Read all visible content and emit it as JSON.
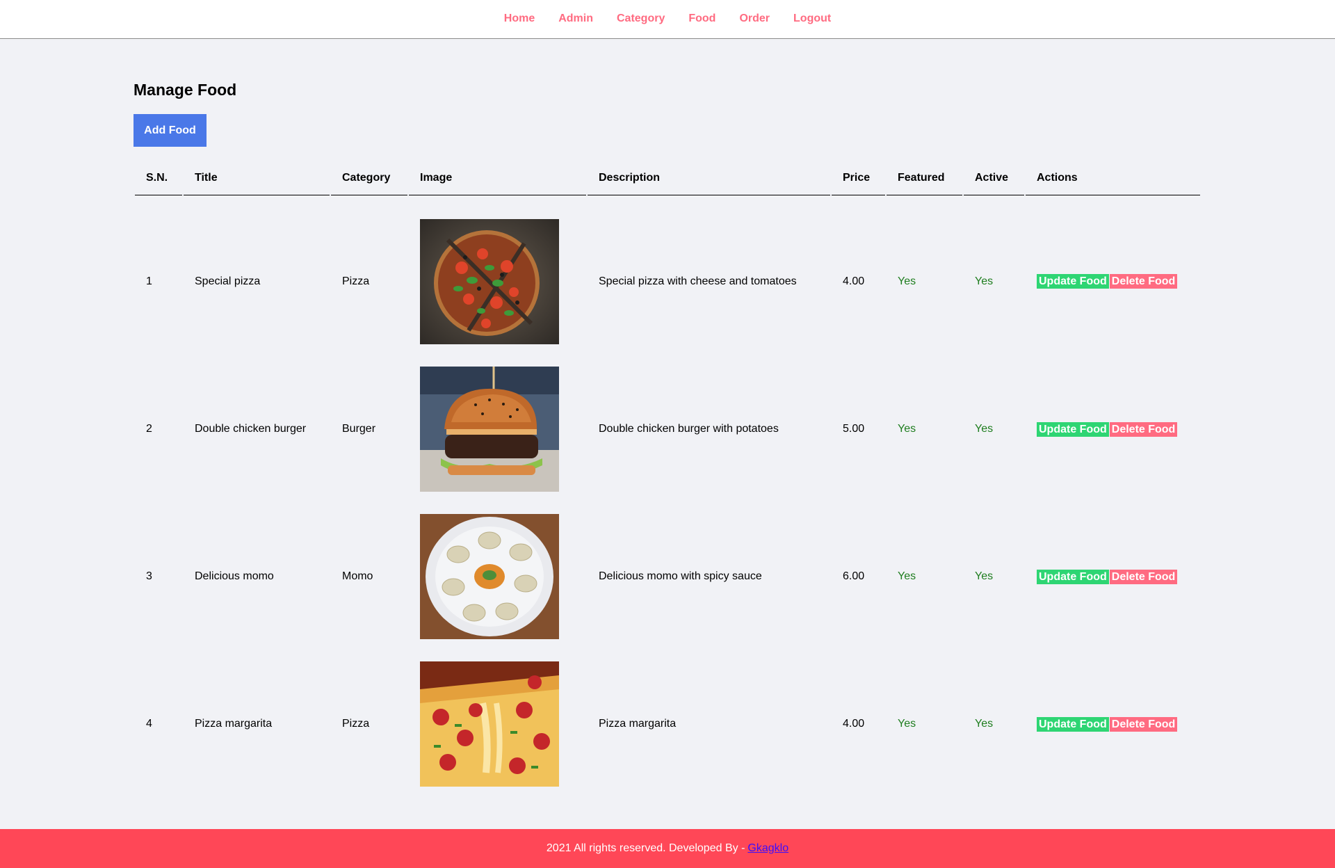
{
  "nav": {
    "items": [
      {
        "label": "Home"
      },
      {
        "label": "Admin"
      },
      {
        "label": "Category"
      },
      {
        "label": "Food"
      },
      {
        "label": "Order"
      },
      {
        "label": "Logout"
      }
    ],
    "color": "#ff6b81"
  },
  "main": {
    "title": "Manage Food",
    "add_button_label": "Add Food",
    "add_button_color": "#4a78e8"
  },
  "table": {
    "headers": [
      "S.N.",
      "Title",
      "Category",
      "Image",
      "Description",
      "Price",
      "Featured",
      "Active",
      "Actions"
    ],
    "rows": [
      {
        "sn": "1",
        "title": "Special pizza",
        "category": "Pizza",
        "image_icon": "pizza-slices-image",
        "description": "Special pizza with cheese and tomatoes",
        "price": "4.00",
        "featured": "Yes",
        "active": "Yes"
      },
      {
        "sn": "2",
        "title": "Double chicken burger",
        "category": "Burger",
        "image_icon": "burger-image",
        "description": "Double chicken burger with potatoes",
        "price": "5.00",
        "featured": "Yes",
        "active": "Yes"
      },
      {
        "sn": "3",
        "title": "Delicious momo",
        "category": "Momo",
        "image_icon": "momo-plate-image",
        "description": "Delicious momo with spicy sauce",
        "price": "6.00",
        "featured": "Yes",
        "active": "Yes"
      },
      {
        "sn": "4",
        "title": "Pizza margarita",
        "category": "Pizza",
        "image_icon": "pizza-cheese-pull-image",
        "description": "Pizza margarita",
        "price": "4.00",
        "featured": "Yes",
        "active": "Yes"
      }
    ],
    "update_label": "Update Food",
    "delete_label": "Delete Food",
    "update_color": "#2ed573",
    "delete_color": "#ff6b81",
    "yes_color": "#1e7d1e"
  },
  "footer": {
    "text": "2021 All rights reserved. Developed By -",
    "link_label": "Gkagklo",
    "background": "#ff4757"
  }
}
